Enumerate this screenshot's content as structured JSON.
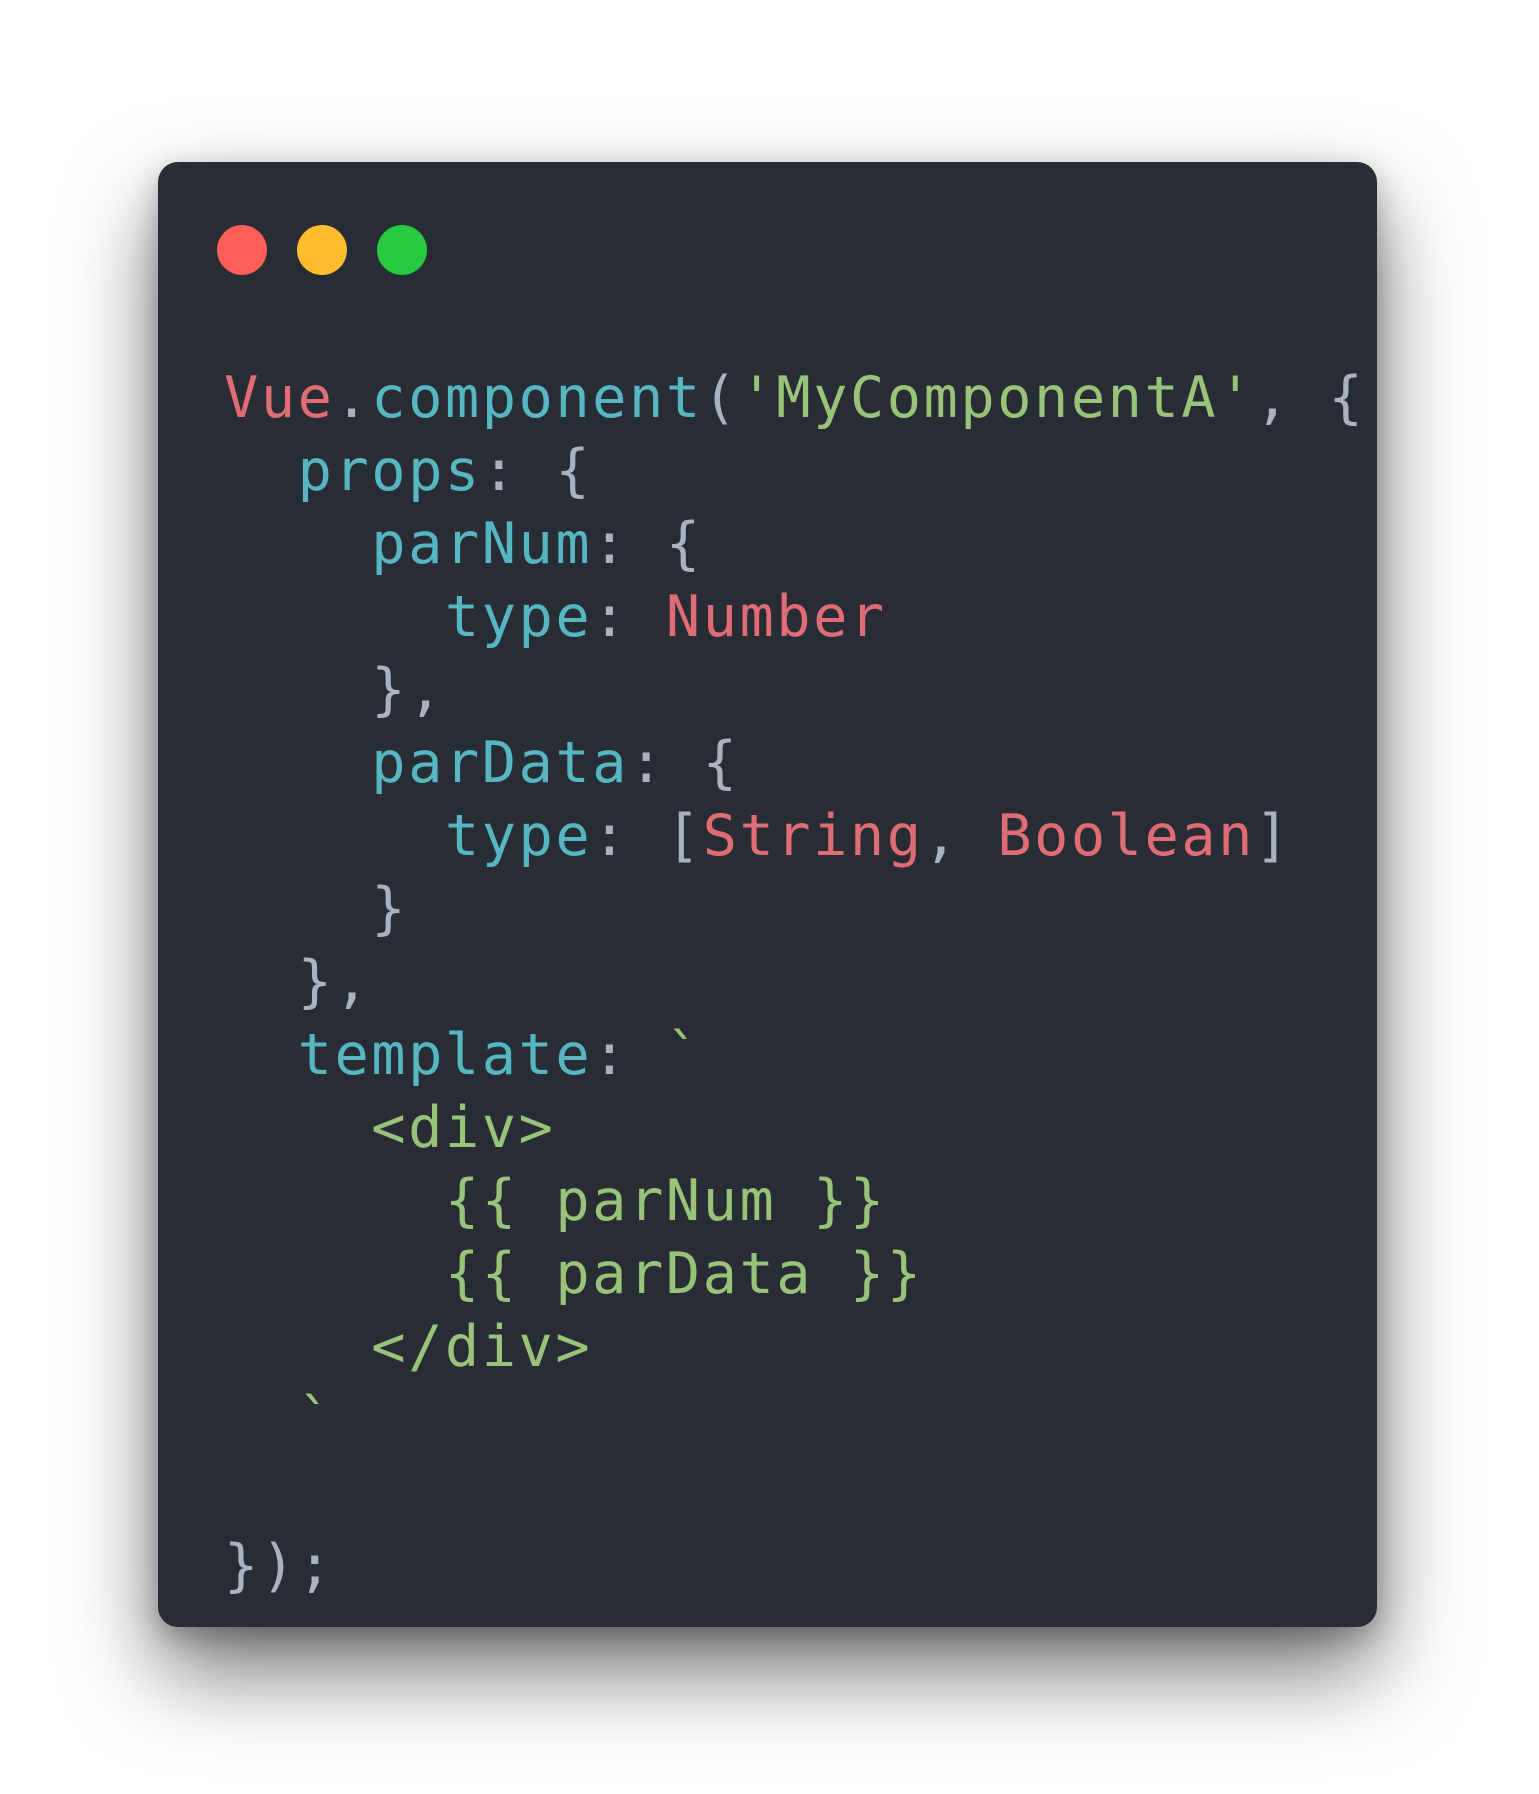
{
  "window": {
    "background": "#282c34",
    "controls": [
      {
        "name": "close",
        "color": "#ff5f56"
      },
      {
        "name": "minimize",
        "color": "#ffbd2e"
      },
      {
        "name": "zoom",
        "color": "#27c93f"
      }
    ]
  },
  "colors": {
    "red": "#e06c75",
    "cyan": "#56b6c2",
    "green": "#98c379",
    "punct": "#abb2bf"
  },
  "code_lines": [
    [
      {
        "t": "Vue",
        "c": "red"
      },
      {
        "t": ".",
        "c": "punct"
      },
      {
        "t": "component",
        "c": "cyan"
      },
      {
        "t": "(",
        "c": "punct"
      },
      {
        "t": "'MyComponentA'",
        "c": "green"
      },
      {
        "t": ", {",
        "c": "punct"
      }
    ],
    [
      {
        "t": "  ",
        "c": "punct"
      },
      {
        "t": "props",
        "c": "cyan"
      },
      {
        "t": ": {",
        "c": "punct"
      }
    ],
    [
      {
        "t": "    ",
        "c": "punct"
      },
      {
        "t": "parNum",
        "c": "cyan"
      },
      {
        "t": ": {",
        "c": "punct"
      }
    ],
    [
      {
        "t": "      ",
        "c": "punct"
      },
      {
        "t": "type",
        "c": "cyan"
      },
      {
        "t": ": ",
        "c": "punct"
      },
      {
        "t": "Number",
        "c": "red"
      }
    ],
    [
      {
        "t": "    },",
        "c": "punct"
      }
    ],
    [
      {
        "t": "    ",
        "c": "punct"
      },
      {
        "t": "parData",
        "c": "cyan"
      },
      {
        "t": ": {",
        "c": "punct"
      }
    ],
    [
      {
        "t": "      ",
        "c": "punct"
      },
      {
        "t": "type",
        "c": "cyan"
      },
      {
        "t": ": [",
        "c": "punct"
      },
      {
        "t": "String",
        "c": "red"
      },
      {
        "t": ", ",
        "c": "punct"
      },
      {
        "t": "Boolean",
        "c": "red"
      },
      {
        "t": "]",
        "c": "punct"
      }
    ],
    [
      {
        "t": "    }",
        "c": "punct"
      }
    ],
    [
      {
        "t": "  },",
        "c": "punct"
      }
    ],
    [
      {
        "t": "  ",
        "c": "punct"
      },
      {
        "t": "template",
        "c": "cyan"
      },
      {
        "t": ": ",
        "c": "punct"
      },
      {
        "t": "`",
        "c": "green"
      }
    ],
    [
      {
        "t": "    ",
        "c": "punct"
      },
      {
        "t": "<div>",
        "c": "green"
      }
    ],
    [
      {
        "t": "      ",
        "c": "punct"
      },
      {
        "t": "{{ parNum }}",
        "c": "green"
      }
    ],
    [
      {
        "t": "      ",
        "c": "punct"
      },
      {
        "t": "{{ parData }}",
        "c": "green"
      }
    ],
    [
      {
        "t": "    ",
        "c": "punct"
      },
      {
        "t": "</div>",
        "c": "green"
      }
    ],
    [
      {
        "t": "  ",
        "c": "punct"
      },
      {
        "t": "`",
        "c": "green"
      }
    ],
    [],
    [
      {
        "t": "});",
        "c": "punct"
      }
    ]
  ]
}
